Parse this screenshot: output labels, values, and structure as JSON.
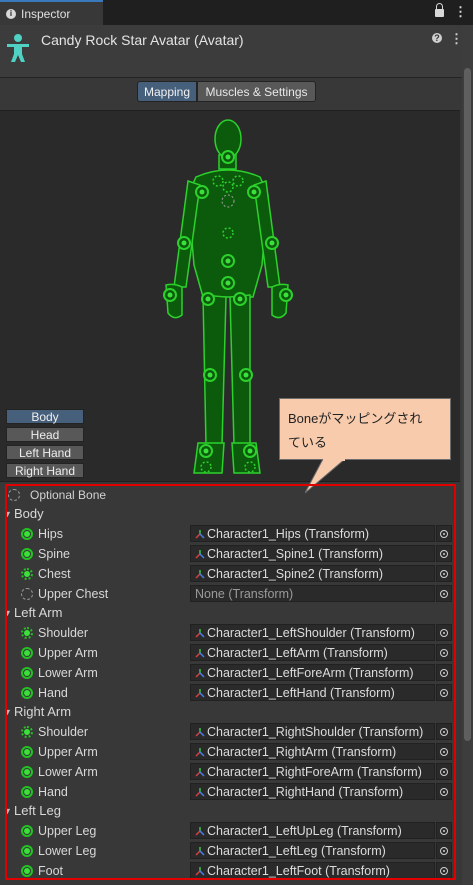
{
  "tab": {
    "title": "Inspector"
  },
  "header": {
    "title": "Candy Rock Star Avatar (Avatar)",
    "help_icon": "help-icon",
    "menu_icon": "kebab-menu-icon"
  },
  "toolbar": {
    "mapping_label": "Mapping",
    "muscles_label": "Muscles & Settings",
    "active": "Mapping"
  },
  "body_parts": {
    "body": "Body",
    "head": "Head",
    "left_hand": "Left Hand",
    "right_hand": "Right Hand",
    "selected": "Body"
  },
  "callout": {
    "line1": "Boneがマッピングされ",
    "line2": "ている"
  },
  "legend": {
    "optional_label": "Optional Bone"
  },
  "groups": [
    {
      "label": "Body",
      "bones": [
        {
          "label": "Hips",
          "value": "Character1_Hips (Transform)"
        },
        {
          "label": "Spine",
          "value": "Character1_Spine1 (Transform)"
        },
        {
          "label": "Chest",
          "value": "Character1_Spine2 (Transform)"
        },
        {
          "label": "Upper Chest",
          "value": "None (Transform)"
        }
      ]
    },
    {
      "label": "Left Arm",
      "bones": [
        {
          "label": "Shoulder",
          "value": "Character1_LeftShoulder (Transform)"
        },
        {
          "label": "Upper Arm",
          "value": "Character1_LeftArm (Transform)"
        },
        {
          "label": "Lower Arm",
          "value": "Character1_LeftForeArm (Transform)"
        },
        {
          "label": "Hand",
          "value": "Character1_LeftHand (Transform)"
        }
      ]
    },
    {
      "label": "Right Arm",
      "bones": [
        {
          "label": "Shoulder",
          "value": "Character1_RightShoulder (Transform)"
        },
        {
          "label": "Upper Arm",
          "value": "Character1_RightArm (Transform)"
        },
        {
          "label": "Lower Arm",
          "value": "Character1_RightForeArm (Transform)"
        },
        {
          "label": "Hand",
          "value": "Character1_RightHand (Transform)"
        }
      ]
    },
    {
      "label": "Left Leg",
      "bones": [
        {
          "label": "Upper Leg",
          "value": "Character1_LeftUpLeg (Transform)"
        },
        {
          "label": "Lower Leg",
          "value": "Character1_LeftLeg (Transform)"
        },
        {
          "label": "Foot",
          "value": "Character1_LeftFoot (Transform)"
        }
      ]
    }
  ],
  "colors": {
    "mapped": "#22c322",
    "highlight": "#e00000",
    "accent": "#46607c",
    "callout_bg": "#f8cbad"
  }
}
